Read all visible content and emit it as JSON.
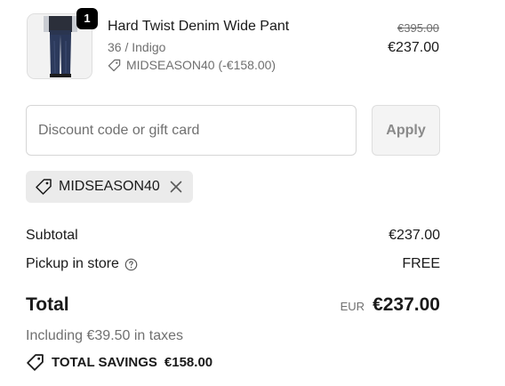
{
  "product": {
    "quantity": "1",
    "name": "Hard Twist Denim Wide Pant",
    "variant": "36 / Indigo",
    "discount_label": "MIDSEASON40 (-€158.00)",
    "original_price": "€395.00",
    "sale_price": "€237.00",
    "image_icon": "denim-pant-thumbnail"
  },
  "discount_form": {
    "placeholder": "Discount code or gift card",
    "value": "",
    "apply_label": "Apply"
  },
  "applied_code": {
    "label": "MIDSEASON40",
    "tag_icon": "tag-icon",
    "remove_icon": "close-icon"
  },
  "summary": {
    "subtotal_label": "Subtotal",
    "subtotal_value": "€237.00",
    "pickup_label": "Pickup in store",
    "pickup_help_icon": "question-circle-icon",
    "pickup_value": "FREE",
    "total_label": "Total",
    "currency": "EUR",
    "total_value": "€237.00",
    "taxes_text": "Including €39.50 in taxes",
    "savings_label": "TOTAL SAVINGS",
    "savings_value": "€158.00"
  },
  "colors": {
    "text": "#1a1a1a",
    "muted": "#707070",
    "chip_bg": "#ebebeb",
    "button_bg": "#f4f4f4",
    "badge_bg": "#000000"
  }
}
